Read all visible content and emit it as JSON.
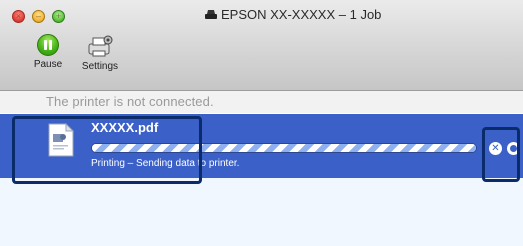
{
  "window": {
    "title": "EPSON XX-XXXXX – 1 Job",
    "title_icon": "printer-icon"
  },
  "toolbar": {
    "pause_label": "Pause",
    "pause_icon": "pause-icon",
    "settings_label": "Settings",
    "settings_icon": "settings-icon"
  },
  "status": {
    "message": "The printer is not connected."
  },
  "job": {
    "name": "XXXXX.pdf",
    "status": "Printing – Sending data to printer.",
    "progress": 1.0,
    "selected_color": "#3b60c8",
    "cancel_icon": "cancel-icon",
    "info_icon": "info-icon",
    "doc_icon": "pdf-document-icon"
  },
  "colors": {
    "selection": "#3b60c8",
    "callout_border": "#0b2c6b",
    "status_text": "#9a9a9a"
  }
}
